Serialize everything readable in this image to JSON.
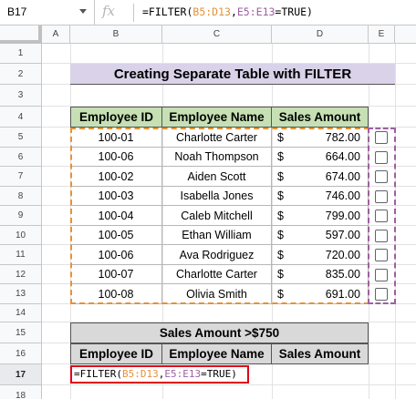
{
  "name_box": "B17",
  "formula_bar": {
    "fx_icon": "fx-icon",
    "prefix": "=FILTER(",
    "range1": "B5:D13",
    "sep": ",",
    "range2": "E5:E13",
    "suffix": "=TRUE)"
  },
  "columns": [
    "A",
    "B",
    "C",
    "D",
    "E"
  ],
  "rows": [
    "1",
    "2",
    "3",
    "4",
    "5",
    "6",
    "7",
    "8",
    "9",
    "10",
    "11",
    "12",
    "13",
    "14",
    "15",
    "16",
    "17",
    "18"
  ],
  "title": "Creating Separate Table with FILTER",
  "table": {
    "headers": [
      "Employee ID",
      "Employee Name",
      "Sales Amount"
    ],
    "currency": "$",
    "rows": [
      {
        "id": "100-01",
        "name": "Charlotte Carter",
        "amount": "782.00"
      },
      {
        "id": "100-06",
        "name": "Noah Thompson",
        "amount": "664.00"
      },
      {
        "id": "100-02",
        "name": "Aiden Scott",
        "amount": "674.00"
      },
      {
        "id": "100-03",
        "name": "Isabella Jones",
        "amount": "746.00"
      },
      {
        "id": "100-04",
        "name": "Caleb Mitchell",
        "amount": "799.00"
      },
      {
        "id": "100-05",
        "name": "Ethan William",
        "amount": "597.00"
      },
      {
        "id": "100-06",
        "name": "Ava Rodriguez",
        "amount": "720.00"
      },
      {
        "id": "100-07",
        "name": "Charlotte Carter",
        "amount": "835.00"
      },
      {
        "id": "100-08",
        "name": "Olivia Smith",
        "amount": "691.00"
      }
    ]
  },
  "filter_table": {
    "title": "Sales Amount >$750",
    "headers": [
      "Employee ID",
      "Employee Name",
      "Sales Amount"
    ]
  },
  "edit_cell": {
    "prefix": "=FILTER(",
    "range1": "B5:D13",
    "sep": ",",
    "range2": "E5:E13",
    "suffix": "=TRUE)"
  },
  "colors": {
    "title_bg": "#d9d2e9",
    "header_bg": "#c6e0b4",
    "filter_header_bg": "#d9d9d9",
    "range1": "#e69138",
    "range2": "#9e5fa3",
    "edit_border": "#e0001b"
  }
}
